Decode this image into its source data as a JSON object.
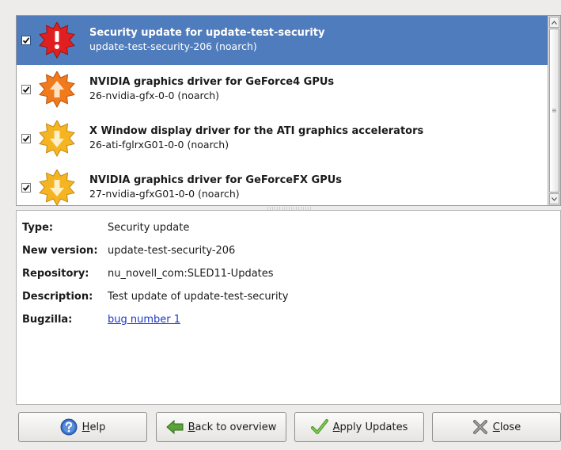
{
  "updates": [
    {
      "title": "Security update for update-test-security",
      "subtitle": "update-test-security-206 (noarch)",
      "checked": true,
      "selected": true,
      "icon": "security-update-icon",
      "icon_color": "#e02020"
    },
    {
      "title": "NVIDIA graphics driver for GeForce4 GPUs",
      "subtitle": "26-nvidia-gfx-0-0 (noarch)",
      "checked": true,
      "selected": false,
      "icon": "important-update-icon",
      "icon_color": "#f07a1c"
    },
    {
      "title": "X Window display driver for the ATI graphics accelerators",
      "subtitle": "26-ati-fglrxG01-0-0 (noarch)",
      "checked": true,
      "selected": false,
      "icon": "optional-update-icon",
      "icon_color": "#f5b422"
    },
    {
      "title": "NVIDIA graphics driver for GeForceFX GPUs",
      "subtitle": "27-nvidia-gfxG01-0-0 (noarch)",
      "checked": true,
      "selected": false,
      "icon": "optional-update-icon",
      "icon_color": "#f5b422"
    }
  ],
  "details": {
    "type_label": "Type:",
    "type_value": "Security update",
    "version_label": "New version:",
    "version_value": "update-test-security-206",
    "repo_label": "Repository:",
    "repo_value": "nu_novell_com:SLED11-Updates",
    "desc_label": "Description:",
    "desc_value": "Test update of update-test-security",
    "bugzilla_label": "Bugzilla:",
    "bugzilla_link": "bug number 1"
  },
  "buttons": {
    "help": {
      "accel": "H",
      "rest": "elp",
      "icon": "help-icon"
    },
    "back": {
      "accel": "B",
      "rest": "ack to overview",
      "icon": "back-arrow-icon"
    },
    "apply": {
      "accel": "A",
      "rest": "pply Updates",
      "icon": "checkmark-icon"
    },
    "close": {
      "accel": "C",
      "rest": "lose",
      "icon": "close-icon"
    }
  },
  "colors": {
    "selection": "#4f7cbc",
    "link": "#1f36c8",
    "security": "#e02020",
    "important": "#f07a1c",
    "optional": "#f5b422"
  }
}
